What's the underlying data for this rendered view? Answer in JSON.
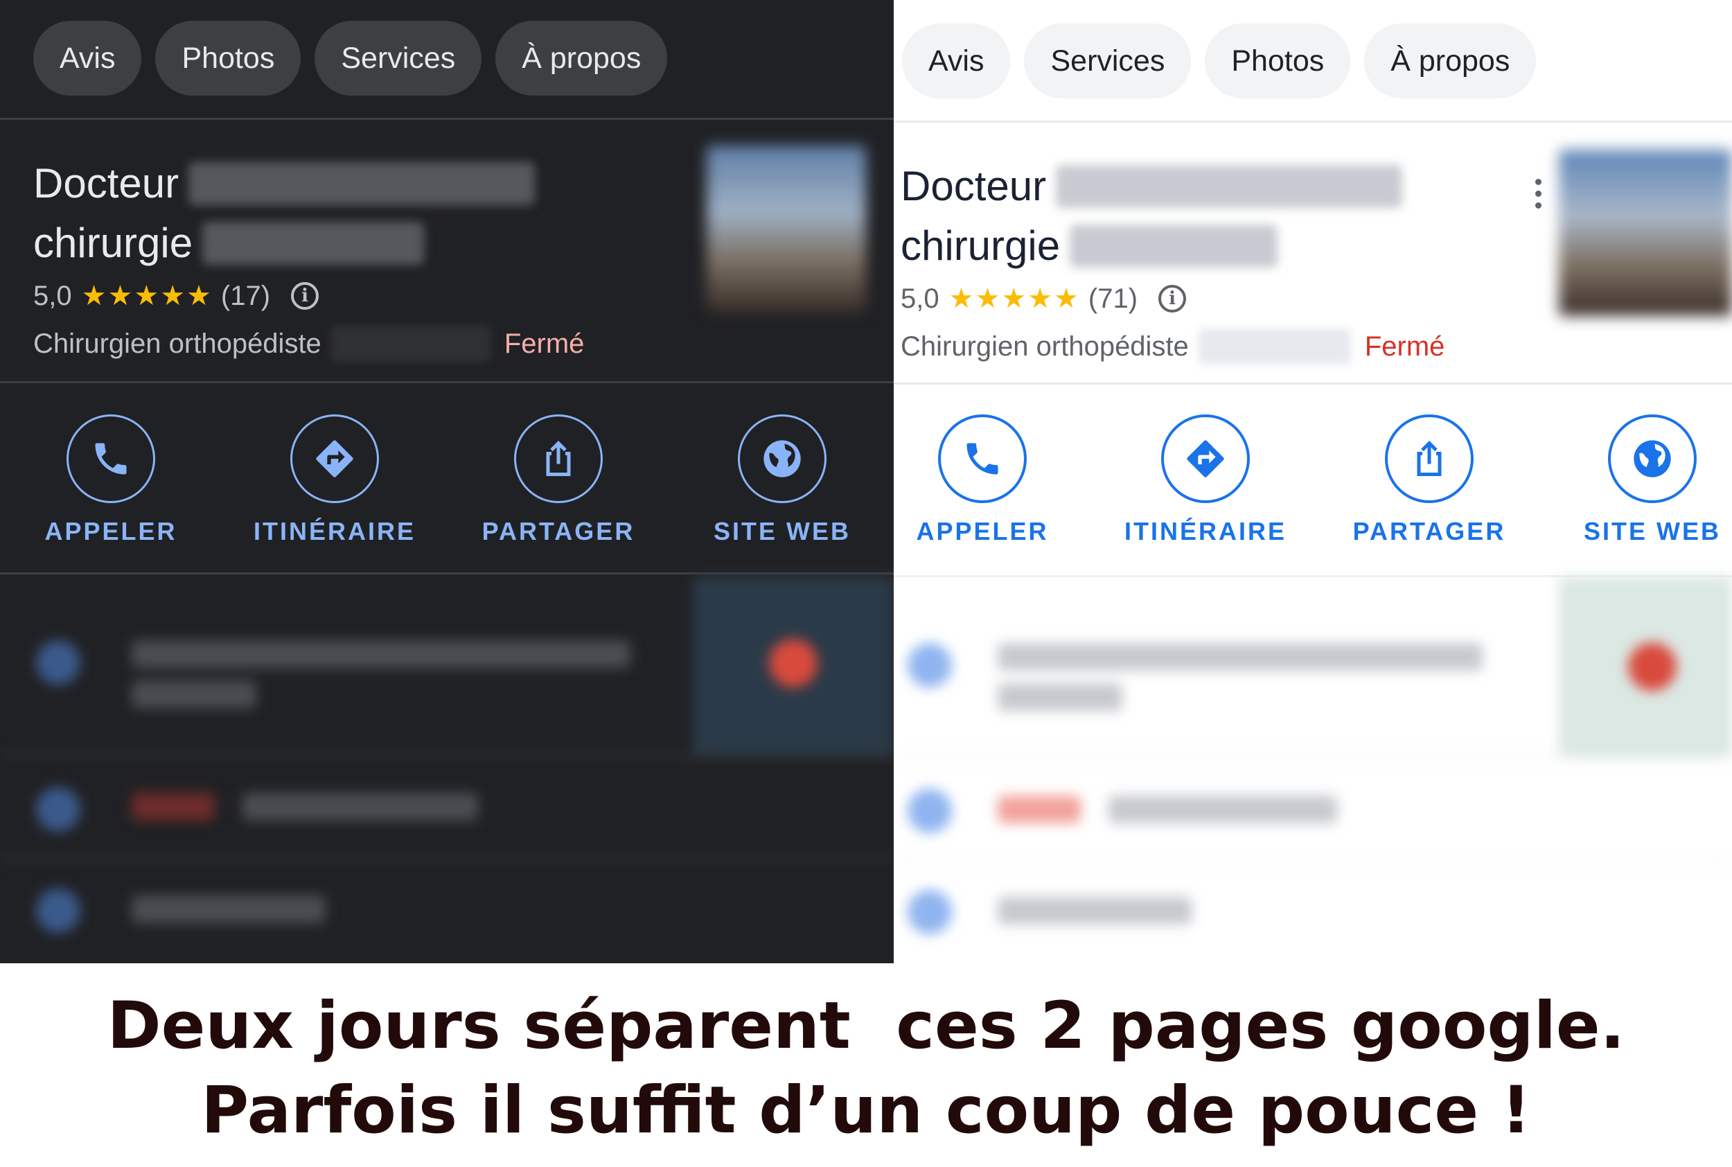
{
  "dark": {
    "tabs": [
      "Avis",
      "Photos",
      "Services",
      "À propos"
    ],
    "title_line1": "Docteur",
    "title_line2": "chirurgie",
    "rating": "5,0",
    "stars": "★★★★★",
    "review_count": "(17)",
    "info_glyph": "i",
    "category": "Chirurgien orthopédiste",
    "status": "Fermé",
    "actions": [
      "APPELER",
      "ITINÉRAIRE",
      "PARTAGER",
      "SITE WEB"
    ]
  },
  "light": {
    "tabs": [
      "Avis",
      "Services",
      "Photos",
      "À propos"
    ],
    "title_line1": "Docteur",
    "title_line2": "chirurgie",
    "rating": "5,0",
    "stars": "★★★★★",
    "review_count": "(71)",
    "info_glyph": "i",
    "category": "Chirurgien orthopédiste",
    "status": "Fermé",
    "actions": [
      "APPELER",
      "ITINÉRAIRE",
      "PARTAGER",
      "SITE WEB"
    ]
  },
  "icons": [
    "phone-icon",
    "directions-icon",
    "share-icon",
    "globe-icon"
  ],
  "colors": {
    "dark_bg": "#202124",
    "dark_accent": "#8ab4f8",
    "light_accent": "#1a73e8",
    "star": "#fbbc04",
    "closed_dark": "#f6aea9",
    "closed_light": "#d93025"
  },
  "caption": {
    "line1": "Deux jours séparent  ces 2 pages google.",
    "line2": "Parfois il suffit d’un coup de pouce !"
  }
}
